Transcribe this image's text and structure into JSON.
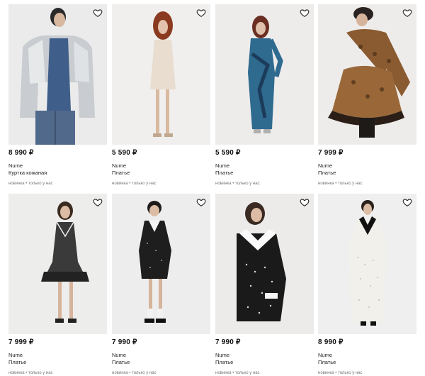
{
  "products": [
    {
      "price": "8 990 ₽",
      "brand": "Nume",
      "name": "Куртка кожаная",
      "tags": "новинка • только у нас"
    },
    {
      "price": "5 590 ₽",
      "brand": "Nume",
      "name": "Платье",
      "tags": "новинка • только у нас"
    },
    {
      "price": "5 590 ₽",
      "brand": "Nume",
      "name": "Платье",
      "tags": "новинка • только у нас"
    },
    {
      "price": "7 999 ₽",
      "brand": "Nume",
      "name": "Платье",
      "tags": "новинка • только у нас"
    },
    {
      "price": "7 999 ₽",
      "brand": "Nume",
      "name": "Платье",
      "tags": "новинка • только у нас"
    },
    {
      "price": "7 990 ₽",
      "brand": "Nume",
      "name": "Платье",
      "tags": "новинка • только у нас"
    },
    {
      "price": "7 990 ₽",
      "brand": "Nume",
      "name": "Платье",
      "tags": "новинка • только у нас"
    },
    {
      "price": "8 990 ₽",
      "brand": "Nume",
      "name": "Платье",
      "tags": "новинка • только у нас"
    }
  ],
  "icons": {
    "favorite": "heart-outline-icon"
  },
  "colors": {
    "photo_bg": "#ececec",
    "text": "#111111",
    "muted": "#777777"
  }
}
